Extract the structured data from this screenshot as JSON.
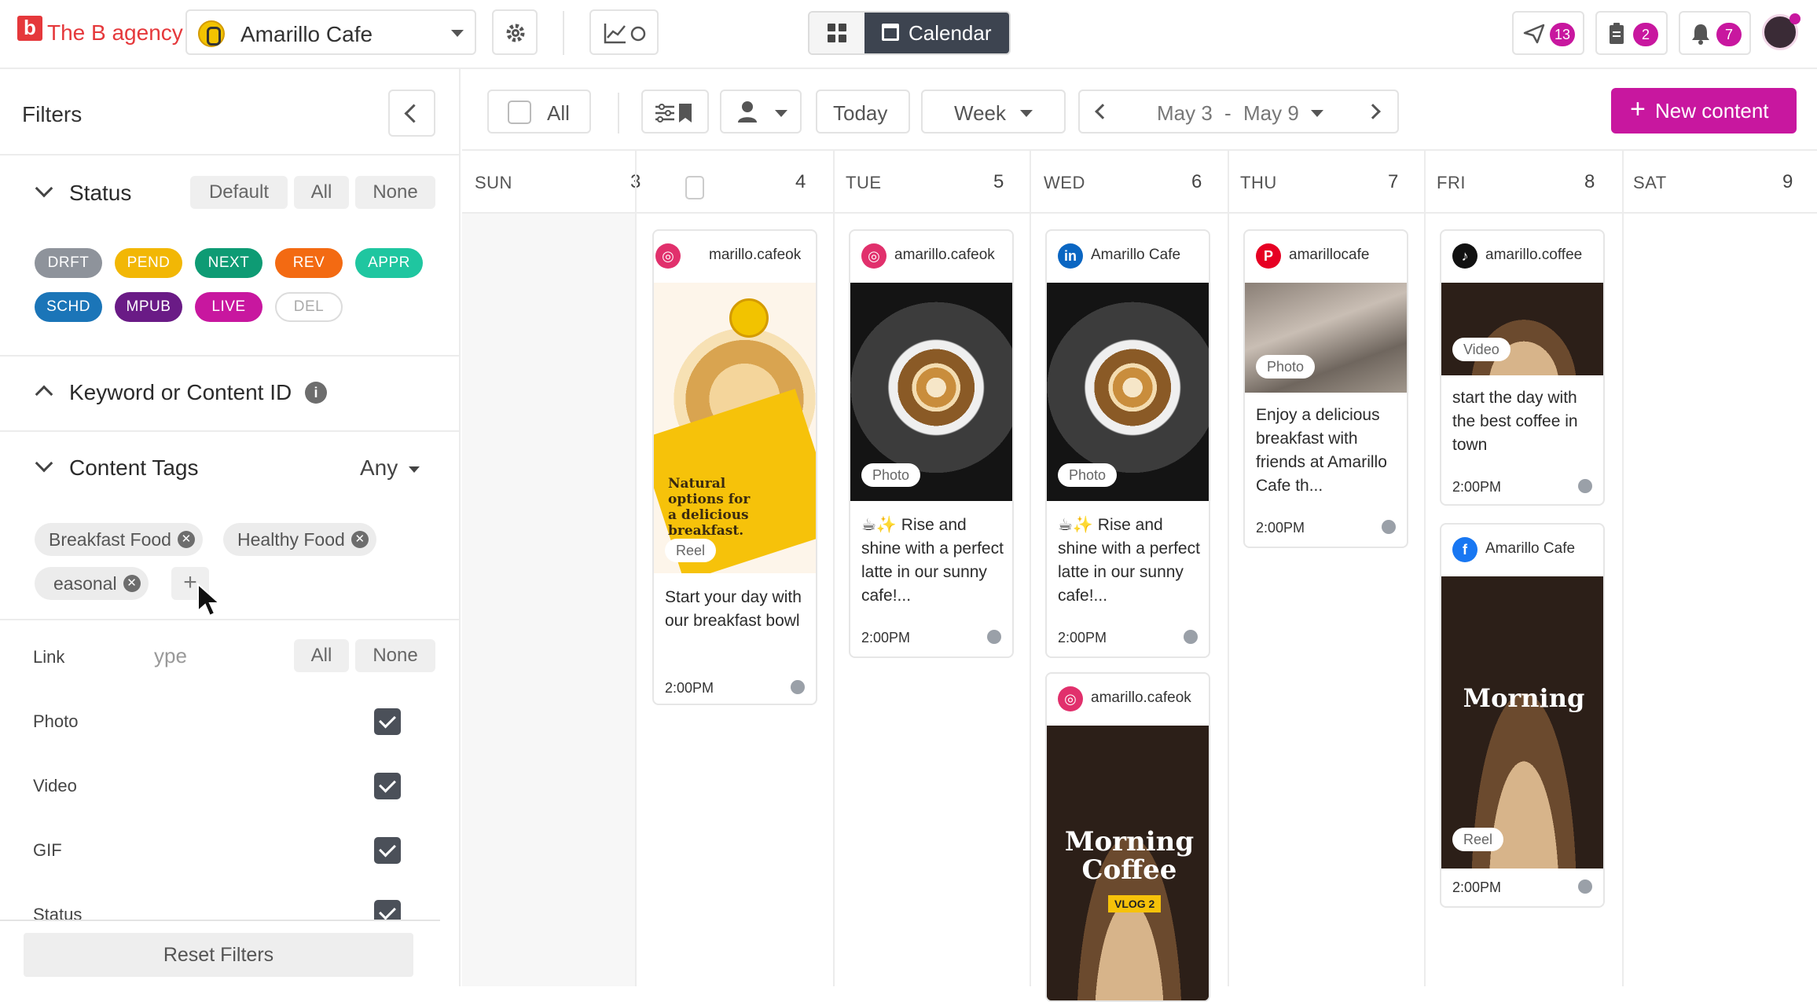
{
  "header": {
    "brand": "The B agency",
    "brand_mark": "b",
    "account": "Amarillo Cafe",
    "view_calendar_label": "Calendar",
    "badges": {
      "send": "13",
      "clipboard": "2",
      "bell": "7"
    }
  },
  "sidebar": {
    "title": "Filters",
    "status": {
      "label": "Status",
      "buttons": [
        "Default",
        "All",
        "None"
      ],
      "chips": [
        {
          "label": "DRFT",
          "color": "#8e939b"
        },
        {
          "label": "PEND",
          "color": "#f2b705"
        },
        {
          "label": "NEXT",
          "color": "#0e9b74"
        },
        {
          "label": "REV",
          "color": "#f36a12"
        },
        {
          "label": "APPR",
          "color": "#1fc6a0"
        },
        {
          "label": "SCHD",
          "color": "#1b75b8"
        },
        {
          "label": "MPUB",
          "color": "#6a1b86"
        },
        {
          "label": "LIVE",
          "color": "#c8179f"
        },
        {
          "label": "DEL",
          "color": "#ffffff"
        }
      ]
    },
    "keyword_label": "Keyword or Content ID",
    "content_tags": {
      "label": "Content Tags",
      "mode": "Any",
      "tags": [
        "Breakfast Food",
        "Healthy Food",
        "easonal"
      ]
    },
    "type_section": {
      "label_partial": "ype",
      "buttons": [
        "All",
        "None"
      ],
      "rows": [
        "Link",
        "Photo",
        "Video",
        "GIF",
        "Status"
      ]
    },
    "reset_label": "Reset Filters"
  },
  "toolbar": {
    "all_label": "All",
    "today_label": "Today",
    "week_label": "Week",
    "range_start": "May 3",
    "range_sep": "-",
    "range_end": "May 9",
    "new_content_label": "New content"
  },
  "calendar": {
    "days": [
      {
        "name": "SUN",
        "num": "3"
      },
      {
        "name": "",
        "num": "4"
      },
      {
        "name": "TUE",
        "num": "5"
      },
      {
        "name": "WED",
        "num": "6"
      },
      {
        "name": "THU",
        "num": "7"
      },
      {
        "name": "FRI",
        "num": "8"
      },
      {
        "name": "SAT",
        "num": "9"
      }
    ],
    "posts": [
      {
        "account": "marillo.cafeok",
        "network": "instagram",
        "media_type": "Reel",
        "caption": "Start your day with our breakfast bowl",
        "time": "2:00PM",
        "overlay_text": "Natural options for a delicious breakfast."
      },
      {
        "account": "amarillo.cafeok",
        "network": "instagram",
        "media_type": "Photo",
        "caption": "☕✨ Rise and shine with a perfect latte in our sunny cafe!...",
        "time": "2:00PM"
      },
      {
        "account": "Amarillo Cafe",
        "network": "linkedin",
        "media_type": "Photo",
        "caption": "☕✨ Rise and shine with a perfect latte in our sunny cafe!...",
        "time": "2:00PM"
      },
      {
        "account": "amarillo.cafeok",
        "network": "instagram",
        "media_type": "",
        "caption": "",
        "time": "",
        "overlay_text": "Morning Coffee",
        "overlay_sub": "VLOG 2"
      },
      {
        "account": "amarillocafe",
        "network": "pinterest",
        "media_type": "Photo",
        "caption": "Enjoy a delicious breakfast with friends at Amarillo Cafe th...",
        "time": "2:00PM"
      },
      {
        "account": "amarillo.coffee",
        "network": "tiktok",
        "media_type": "Video",
        "caption": "start the day with the best coffee in town",
        "time": "2:00PM"
      },
      {
        "account": "Amarillo Cafe",
        "network": "facebook",
        "media_type": "Reel",
        "caption": "",
        "time": "2:00PM",
        "overlay_text": "Morning"
      }
    ]
  },
  "colors": {
    "accent": "#c8179f",
    "brand": "#e5383b",
    "instagram": "#e1306c",
    "linkedin": "#0a66c2",
    "pinterest": "#e60023",
    "tiktok": "#111111",
    "facebook": "#1877f2"
  }
}
